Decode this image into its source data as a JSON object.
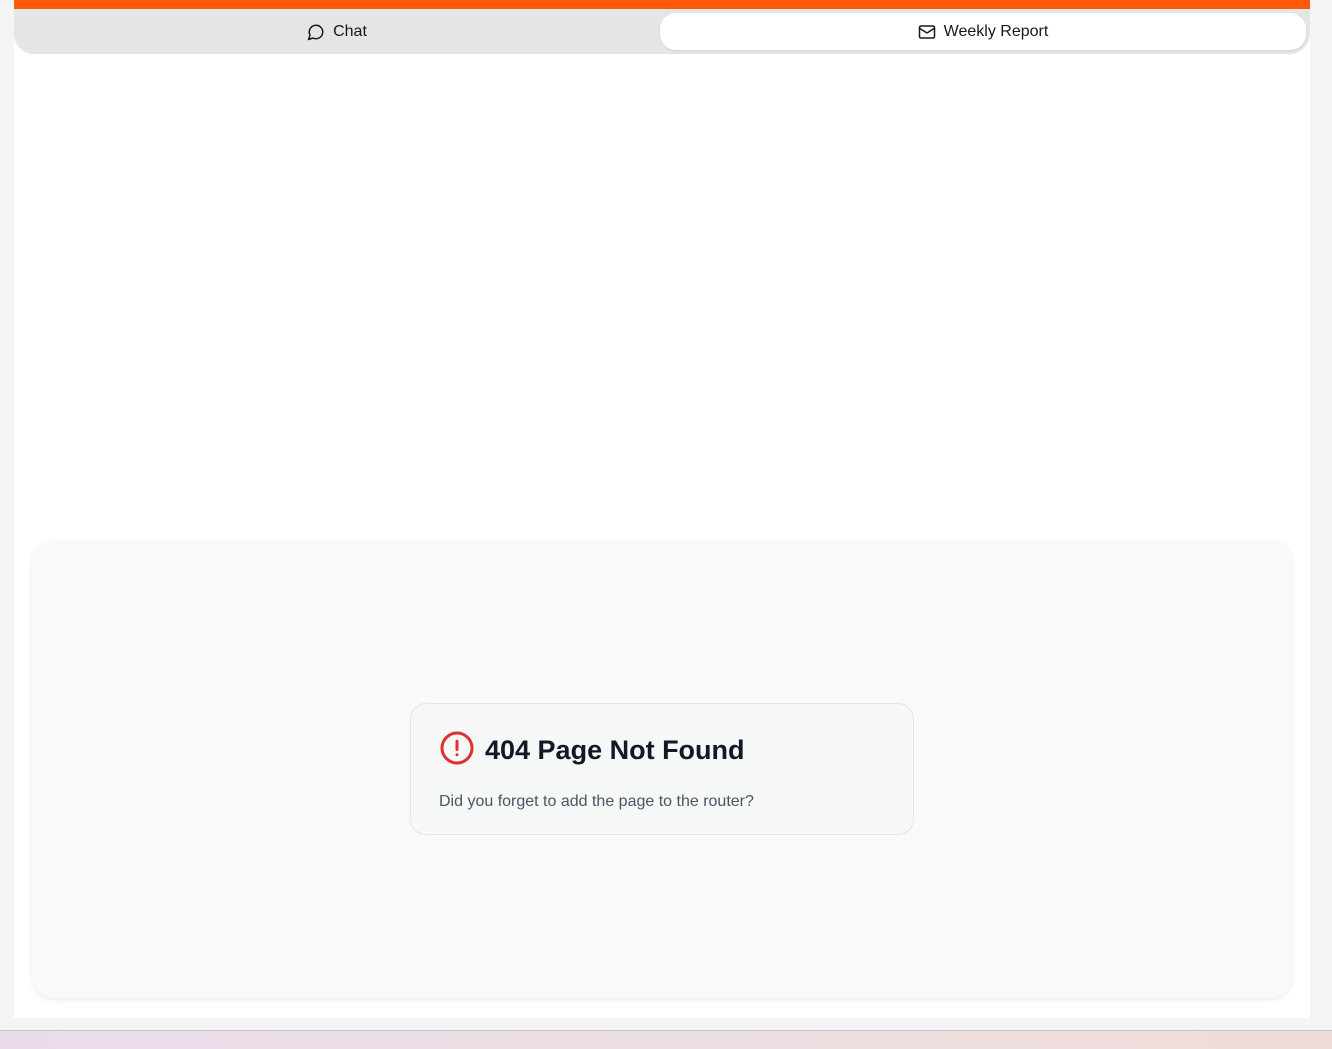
{
  "tabs": [
    {
      "label": "Chat",
      "icon": "chat-bubble-icon",
      "active": false
    },
    {
      "label": "Weekly Report",
      "icon": "mail-icon",
      "active": true
    }
  ],
  "error": {
    "icon": "alert-circle-icon",
    "title": "404 Page Not Found",
    "message": "Did you forget to add the page to the router?"
  },
  "colors": {
    "accent": "#ff5a0a",
    "error": "#e03131"
  }
}
